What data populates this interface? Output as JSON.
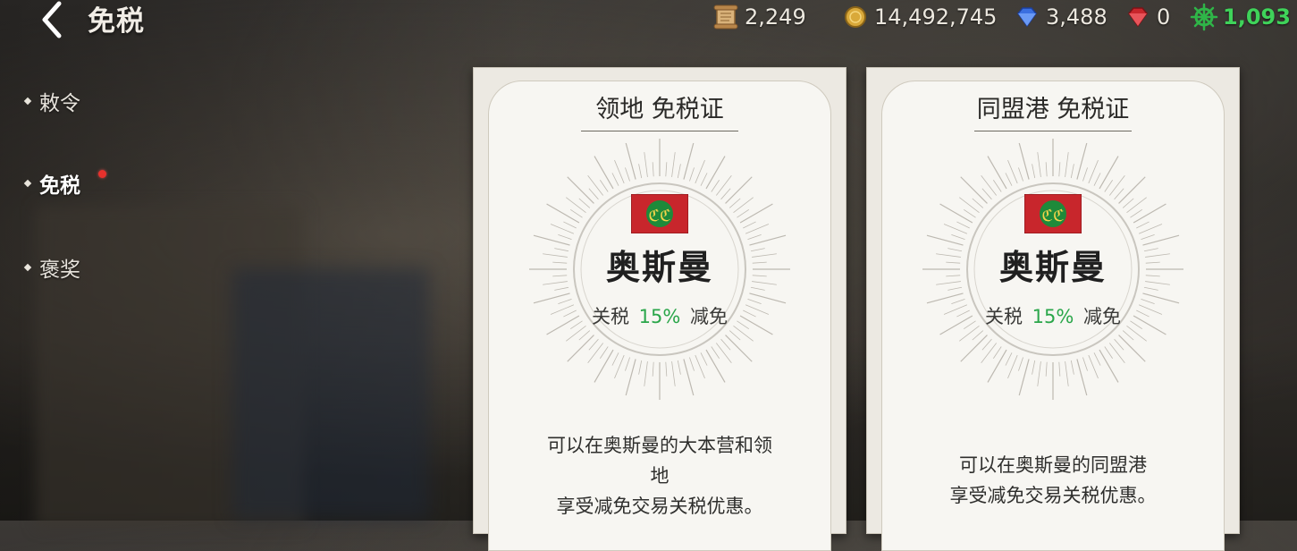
{
  "header": {
    "title": "免税",
    "back_icon": "back-chevron-icon"
  },
  "resources": [
    {
      "icon": "scroll-icon",
      "value": "2,249"
    },
    {
      "icon": "gold-coin-icon",
      "value": "14,492,745"
    },
    {
      "icon": "blue-gem-icon",
      "value": "3,488"
    },
    {
      "icon": "red-gem-icon",
      "value": "0"
    },
    {
      "icon": "ship-wheel-icon",
      "value": "1,093",
      "color": "#3fd35a"
    }
  ],
  "sidebar": {
    "items": [
      {
        "label": "敕令",
        "active": false
      },
      {
        "label": "免税",
        "active": true,
        "notification": true
      },
      {
        "label": "褒奖",
        "active": false
      }
    ]
  },
  "cards": [
    {
      "title": "领地 免税证",
      "country": "奥斯曼",
      "tax_prefix": "关税",
      "tax_percent": "15%",
      "tax_suffix": "减免",
      "description_lines": [
        "可以在奥斯曼的大本营和领",
        "地",
        "享受减免交易关税优惠。"
      ]
    },
    {
      "title": "同盟港 免税证",
      "country": "奥斯曼",
      "tax_prefix": "关税",
      "tax_percent": "15%",
      "tax_suffix": "减免",
      "description_lines": [
        "可以在奥斯曼的同盟港",
        "享受减免交易关税优惠。"
      ]
    }
  ],
  "colors": {
    "accent_green": "#2aa64a",
    "flag_red": "#c8262c",
    "flag_emblem": "#1e8a3a",
    "notification": "#e8312c"
  }
}
